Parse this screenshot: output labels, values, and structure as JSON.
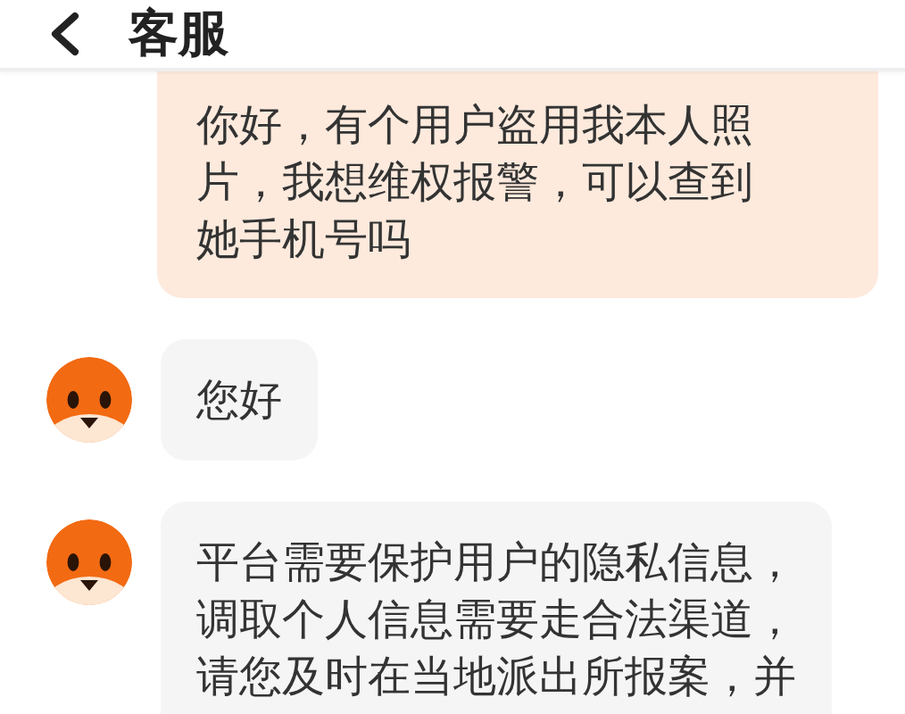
{
  "header": {
    "title": "客服"
  },
  "messages": [
    {
      "kind": "user",
      "text": "你好，有个用户盗用我本人照片，我想维权报警，可以查到她手机号吗"
    },
    {
      "kind": "agent",
      "text": "您好"
    },
    {
      "kind": "agent",
      "text": "平台需要保护用户的隐私信息，调取个人信息需要走合法渠道，请您及时在当地派出所报案，并"
    }
  ]
}
